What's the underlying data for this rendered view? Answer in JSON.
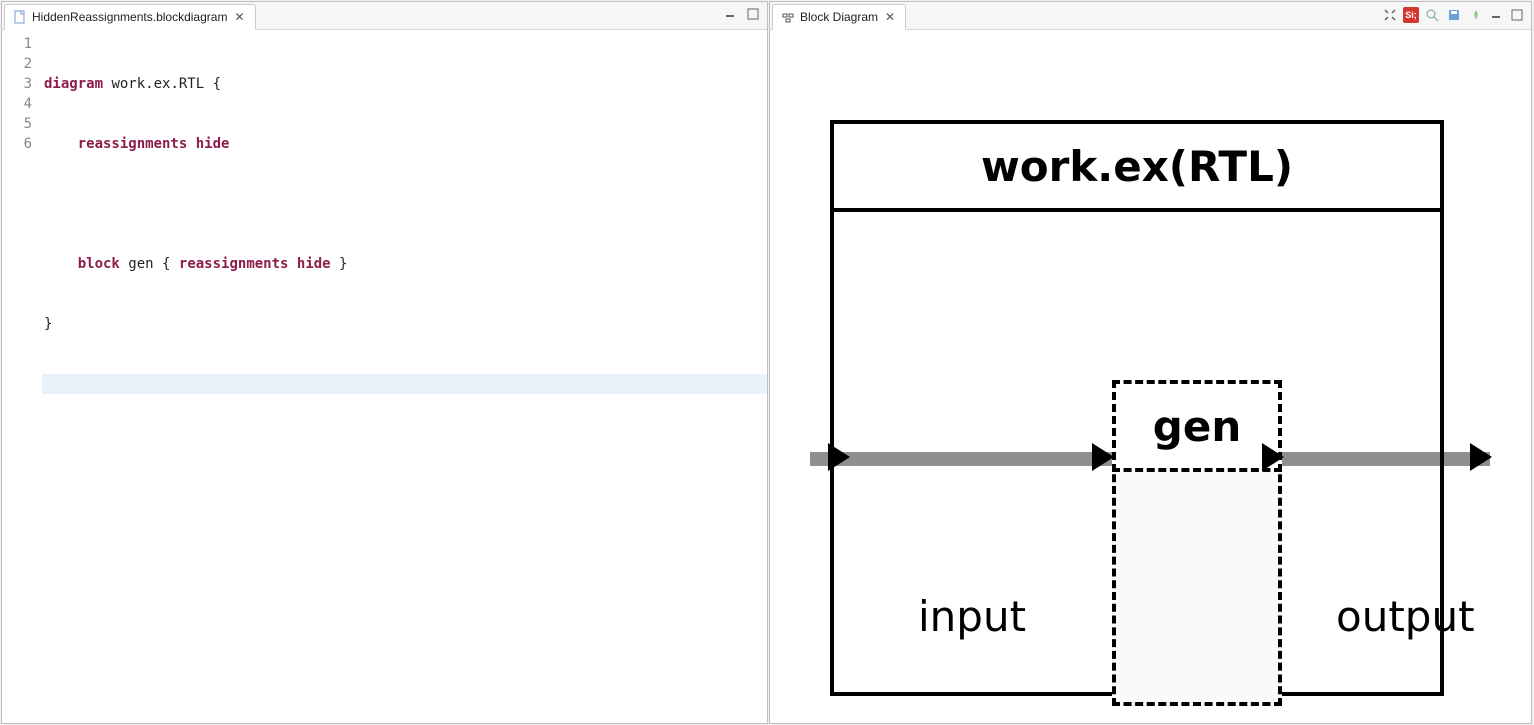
{
  "editor_tab": {
    "filename": "HiddenReassignments.blockdiagram",
    "close_glyph": "✕"
  },
  "editor": {
    "line_numbers": [
      "1",
      "2",
      "3",
      "4",
      "5",
      "6"
    ],
    "lines": {
      "l1_kw": "diagram",
      "l1_rest": " work.ex.RTL {",
      "l2_kw": "reassignments hide",
      "l4_kw1": "block",
      "l4_mid": " gen { ",
      "l4_kw2": "reassignments hide",
      "l4_end": " }",
      "l5": "}"
    }
  },
  "diagram_tab": {
    "title": "Block Diagram",
    "close_glyph": "✕"
  },
  "diagram": {
    "module_title": "work.ex(RTL)",
    "gen_label": "gen",
    "input_label": "input",
    "output_label": "output"
  }
}
